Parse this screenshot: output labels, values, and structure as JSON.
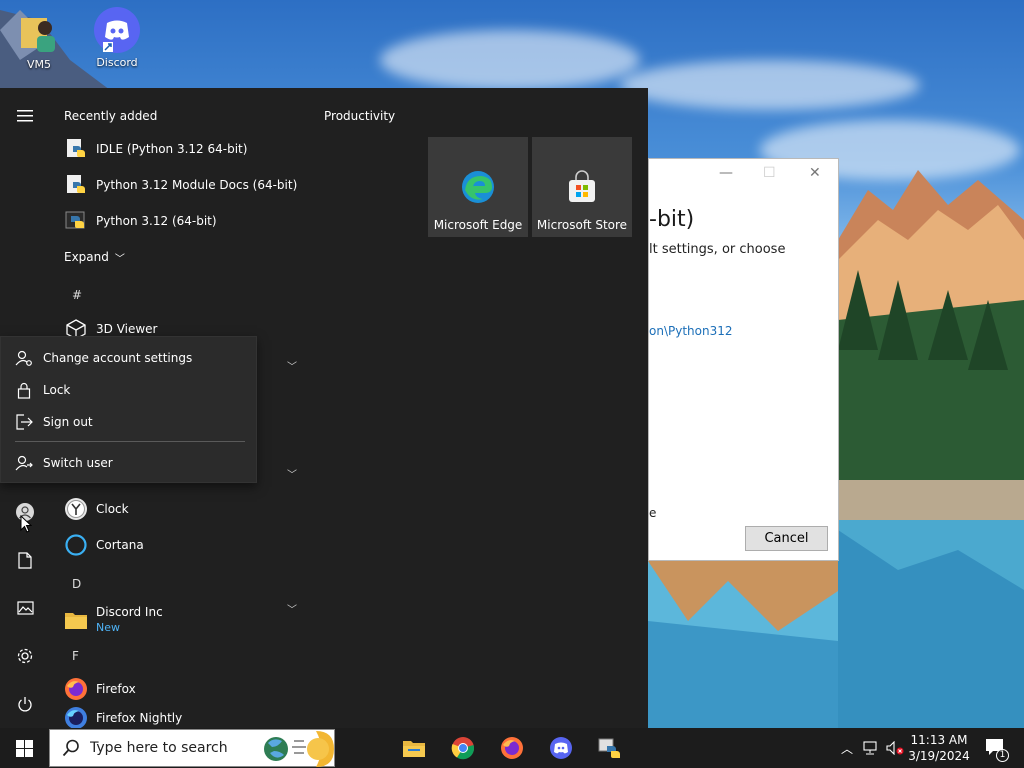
{
  "desktop": {
    "icons": [
      {
        "label": "VM5",
        "icon": "folder-user-icon"
      },
      {
        "label": "Discord",
        "icon": "discord-icon"
      }
    ]
  },
  "dialog": {
    "heading": "-bit)",
    "subtext": "lt settings, or choose",
    "path_text": "on\\Python312",
    "stray_text": "e",
    "cancel_label": "Cancel"
  },
  "start_menu": {
    "recently_added_title": "Recently added",
    "recent_apps": [
      {
        "label": "IDLE (Python 3.12 64-bit)",
        "icon": "python-idle-icon"
      },
      {
        "label": "Python 3.12 Module Docs (64-bit)",
        "icon": "python-docs-icon"
      },
      {
        "label": "Python 3.12 (64-bit)",
        "icon": "python-icon"
      }
    ],
    "expand_label": "Expand",
    "letters": {
      "hash": "#",
      "d": "D",
      "f": "F"
    },
    "apps": {
      "viewer3d": "3D Viewer",
      "clock": "Clock",
      "cortana": "Cortana",
      "discord_inc": "Discord Inc",
      "discord_inc_badge": "New",
      "firefox": "Firefox",
      "firefox_nightly": "Firefox Nightly"
    },
    "productivity_title": "Productivity",
    "tiles": [
      {
        "label": "Microsoft Edge",
        "icon": "edge-icon"
      },
      {
        "label": "Microsoft Store",
        "icon": "store-icon"
      }
    ]
  },
  "account_flyout": {
    "items": [
      {
        "label": "Change account settings",
        "icon": "account-settings-icon"
      },
      {
        "label": "Lock",
        "icon": "lock-icon"
      },
      {
        "label": "Sign out",
        "icon": "sign-out-icon"
      },
      {
        "label": "Switch user",
        "icon": "switch-user-icon"
      }
    ]
  },
  "taskbar": {
    "search_placeholder": "Type here to search",
    "clock_time": "11:13 AM",
    "clock_date": "3/19/2024",
    "notification_count": "1"
  },
  "colors": {
    "start_bg": "#202020",
    "flyout_bg": "#2b2b2b",
    "tile_bg": "#3a3a3a",
    "taskbar_bg": "#1c1c1c",
    "accent_link": "#4fb3f6"
  }
}
